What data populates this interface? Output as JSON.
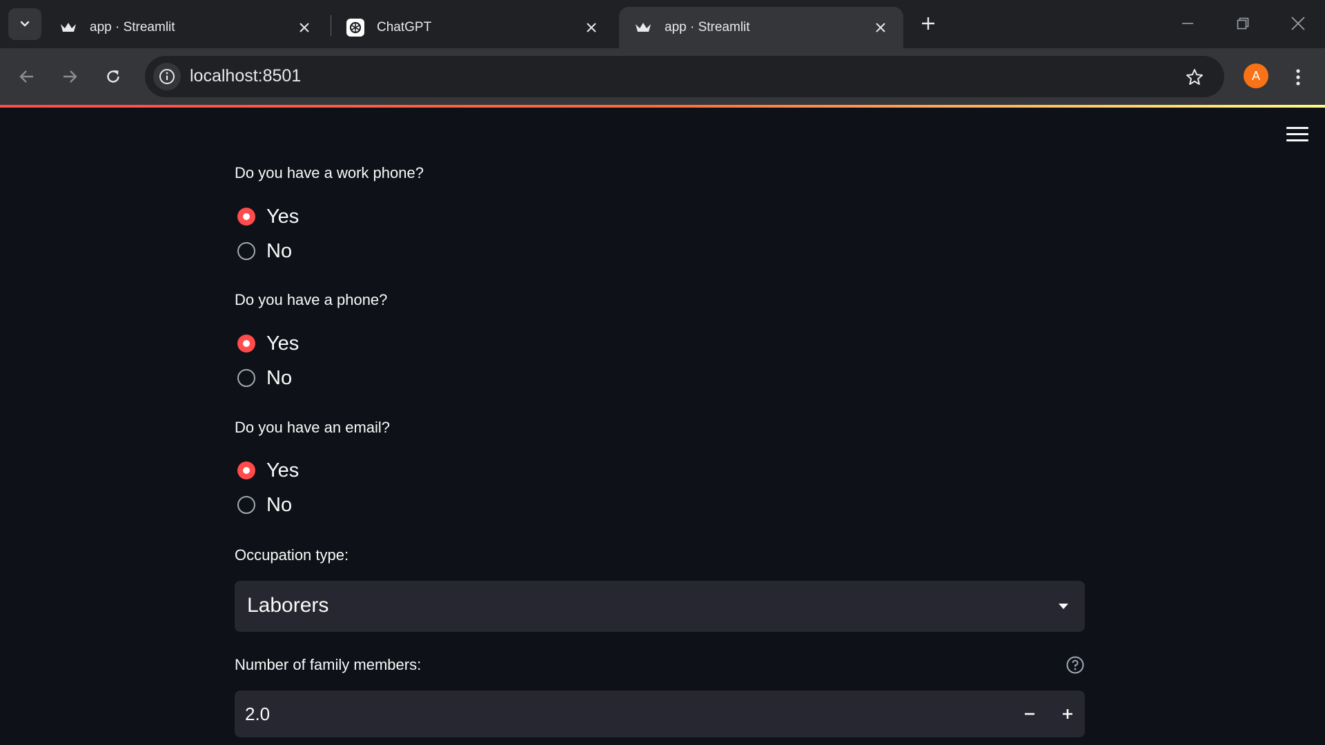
{
  "browser": {
    "tabs": [
      {
        "title": "app · Streamlit",
        "favicon": "streamlit-crown-icon",
        "active": false
      },
      {
        "title": "ChatGPT",
        "favicon": "chatgpt-icon",
        "active": false
      },
      {
        "title": "app · Streamlit",
        "favicon": "streamlit-crown-icon",
        "active": true
      }
    ],
    "url": "localhost:8501",
    "profile_initial": "A",
    "profile_color": "#f97316"
  },
  "form": {
    "work_phone": {
      "label": "Do you have a work phone?",
      "options": [
        "Yes",
        "No"
      ],
      "selected": "Yes"
    },
    "phone": {
      "label": "Do you have a phone?",
      "options": [
        "Yes",
        "No"
      ],
      "selected": "Yes"
    },
    "email": {
      "label": "Do you have an email?",
      "options": [
        "Yes",
        "No"
      ],
      "selected": "Yes"
    },
    "occupation": {
      "label": "Occupation type:",
      "value": "Laborers"
    },
    "family_members": {
      "label": "Number of family members:",
      "value": "2.0"
    }
  },
  "theme": {
    "accent": "#ff4b4b",
    "background": "#0e1117",
    "widget_bg": "#262730"
  }
}
